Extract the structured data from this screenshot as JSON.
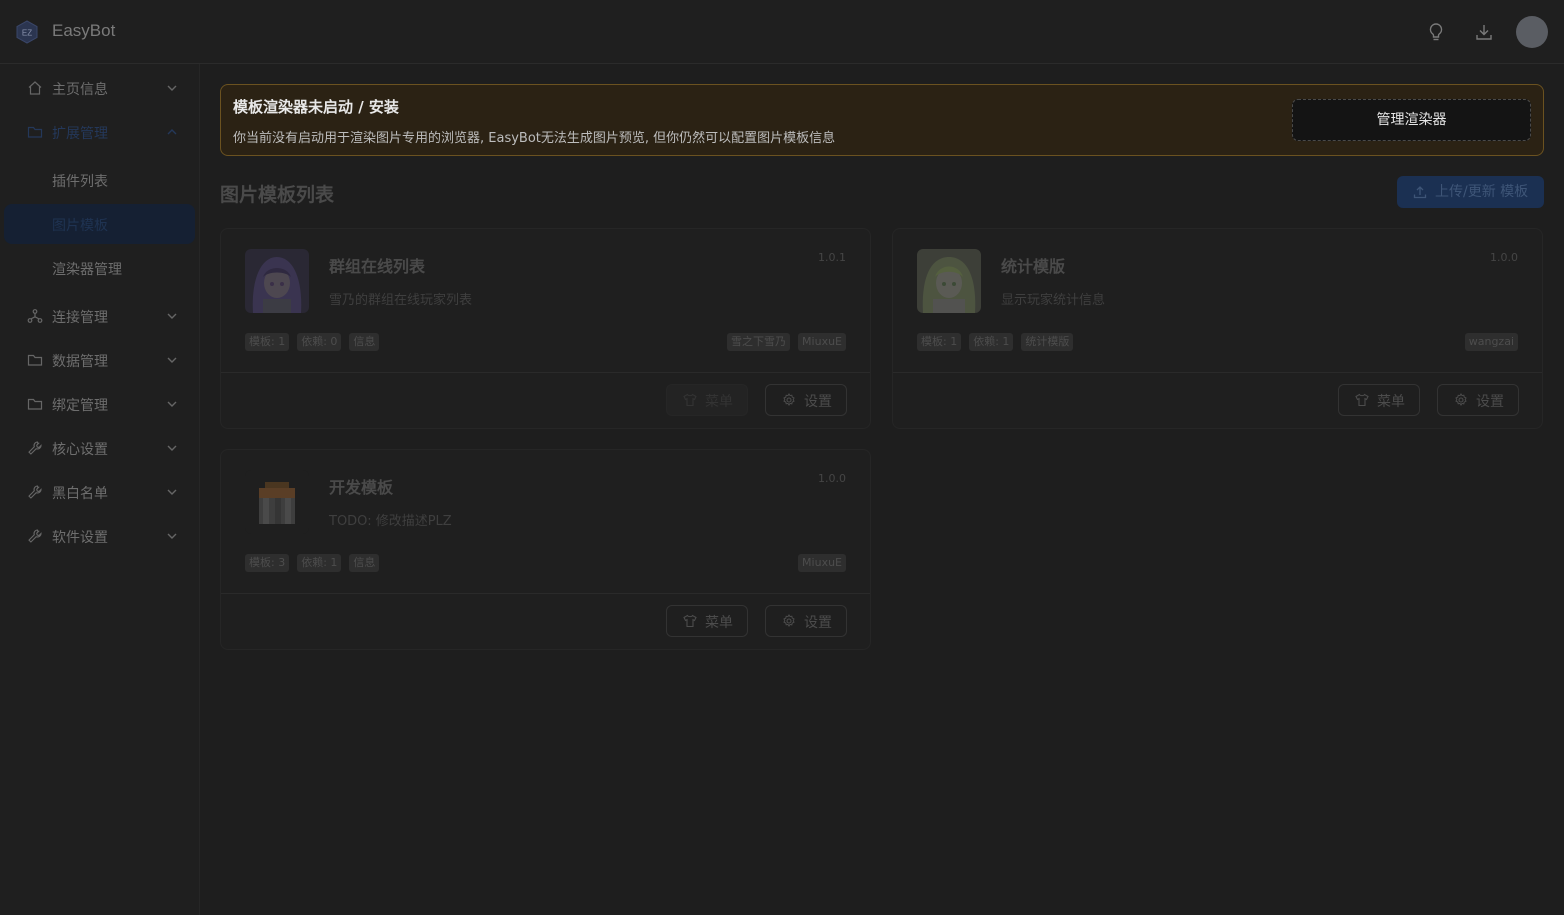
{
  "app": {
    "title": "EasyBot",
    "logo_text": "EZ"
  },
  "sidebar": {
    "items": [
      {
        "label": "主页信息",
        "icon": "home-icon"
      },
      {
        "label": "扩展管理",
        "icon": "folder-icon",
        "expanded": true,
        "children": [
          {
            "label": "插件列表"
          },
          {
            "label": "图片模板",
            "active": true
          },
          {
            "label": "渲染器管理"
          }
        ]
      },
      {
        "label": "连接管理",
        "icon": "network-icon"
      },
      {
        "label": "数据管理",
        "icon": "folder-icon"
      },
      {
        "label": "绑定管理",
        "icon": "folder-icon"
      },
      {
        "label": "核心设置",
        "icon": "wrench-icon"
      },
      {
        "label": "黑白名单",
        "icon": "wrench-icon"
      },
      {
        "label": "软件设置",
        "icon": "wrench-icon"
      }
    ]
  },
  "alert": {
    "title": "模板渲染器未启动 / 安装",
    "description": "你当前没有启动用于渲染图片专用的浏览器, EasyBot无法生成图片预览, 但你仍然可以配置图片模板信息",
    "button": "管理渲染器",
    "border_color": "#6b5220"
  },
  "main": {
    "title": "图片模板列表",
    "upload_button": "上传/更新 模板"
  },
  "cards": [
    {
      "title": "群组在线列表",
      "description": "雪乃的群组在线玩家列表",
      "version": "1.0.1",
      "tags_left": [
        "模板: 1",
        "依赖: 0",
        "信息"
      ],
      "tags_right": [
        "雪之下雪乃",
        "MiuxuE"
      ],
      "menu_label": "菜单",
      "menu_disabled": true,
      "settings_label": "设置"
    },
    {
      "title": "统计模版",
      "description": "显示玩家统计信息",
      "version": "1.0.0",
      "tags_left": [
        "模板: 1",
        "依赖: 1",
        "统计模版"
      ],
      "tags_right": [
        "wangzai"
      ],
      "menu_label": "菜单",
      "menu_disabled": false,
      "settings_label": "设置"
    },
    {
      "title": "开发模板",
      "description": "TODO: 修改描述PLZ",
      "version": "1.0.0",
      "tags_left": [
        "模板: 3",
        "依赖: 1",
        "信息"
      ],
      "tags_right": [
        "MiuxuE"
      ],
      "menu_label": "菜单",
      "menu_disabled": false,
      "settings_label": "设置"
    }
  ]
}
